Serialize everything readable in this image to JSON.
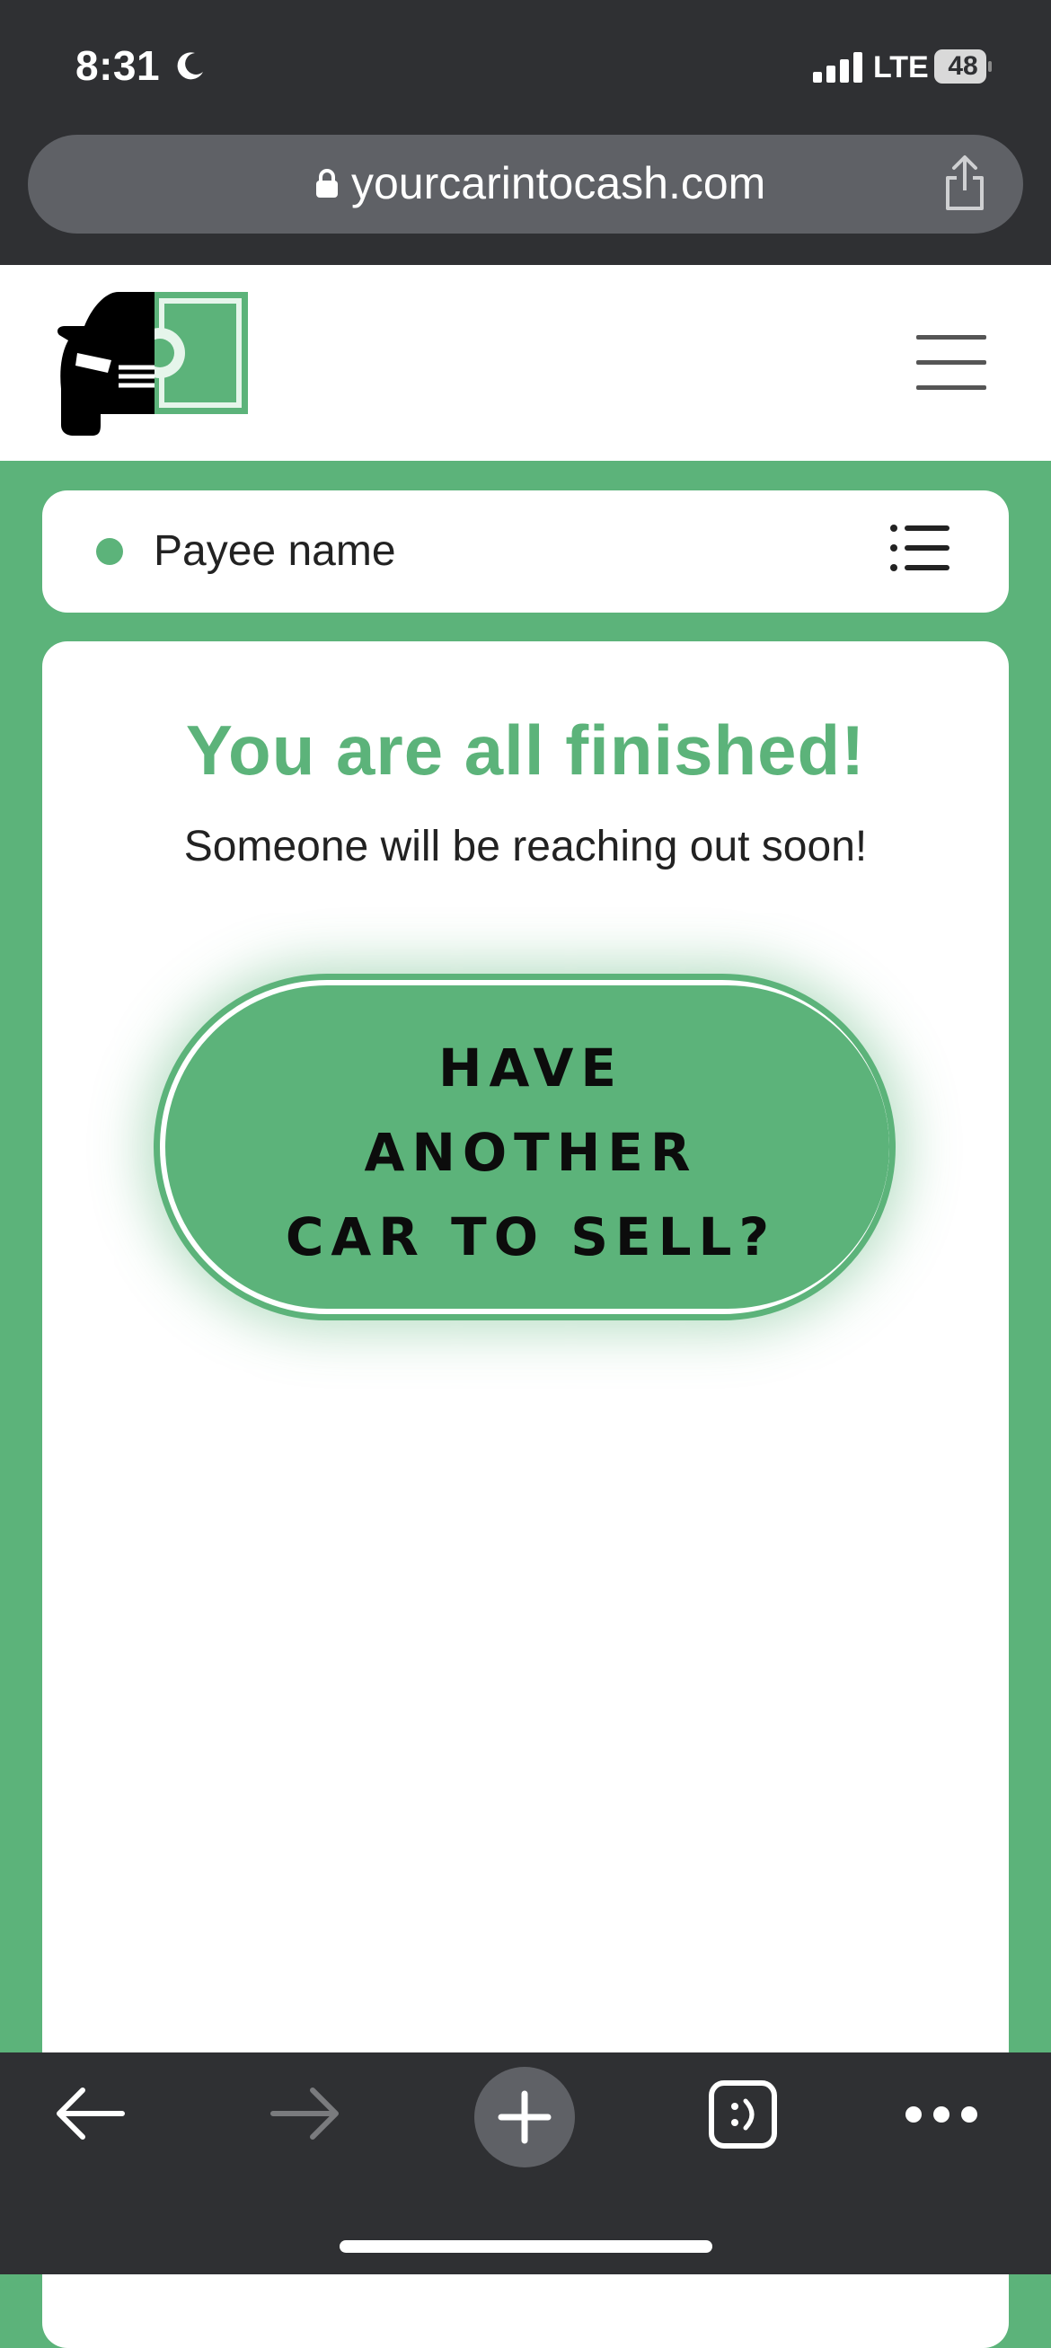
{
  "status_bar": {
    "time": "8:31",
    "network": "LTE",
    "battery": "48"
  },
  "browser": {
    "url": "yourcarintocash.com"
  },
  "payee": {
    "label": "Payee name"
  },
  "main": {
    "title": "You are all finished!",
    "subtitle": "Someone will be reaching out soon!",
    "cta_lines": [
      "HAVE",
      "ANOTHER",
      "CAR TO SELL?"
    ]
  },
  "colors": {
    "brand_green": "#5cb37a",
    "chrome_dark": "#2f3033"
  },
  "icons": {
    "status": [
      "moon-icon",
      "signal-icon",
      "battery-icon"
    ],
    "url_bar": [
      "lock-icon",
      "share-icon"
    ],
    "header": [
      "logo-car-cash-icon",
      "hamburger-menu-icon"
    ],
    "payee": [
      "status-dot-icon",
      "list-icon"
    ],
    "toolbar": [
      "back-arrow-icon",
      "forward-arrow-icon",
      "plus-icon",
      "tabs-icon",
      "more-icon"
    ]
  }
}
